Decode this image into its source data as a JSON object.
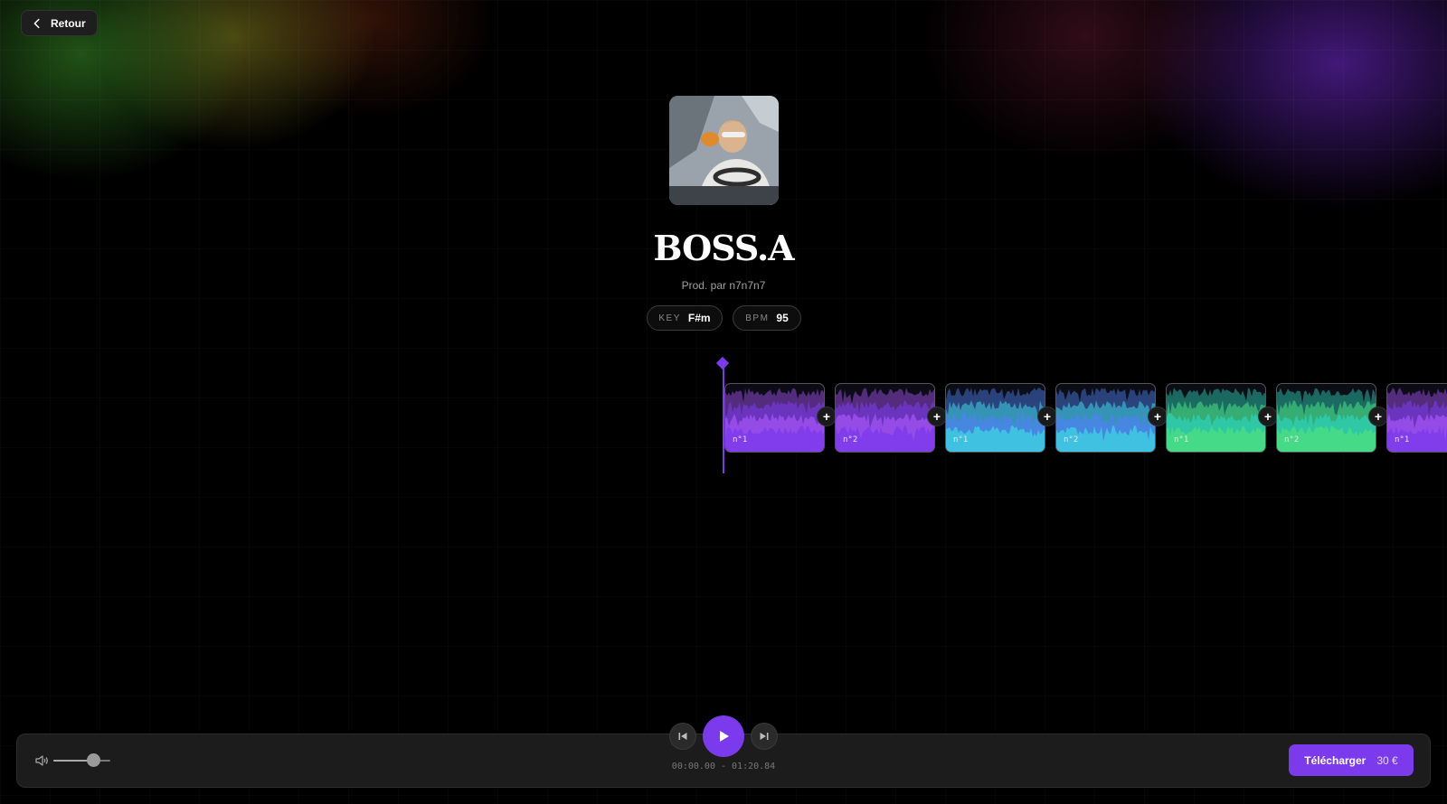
{
  "nav": {
    "back_label": "Retour"
  },
  "track": {
    "title": "BOSS.A",
    "producer": "Prod. par n7n7n7",
    "key_label": "KEY",
    "key_value": "F#m",
    "bpm_label": "BPM",
    "bpm_value": "95"
  },
  "timeline": {
    "clips": [
      {
        "label": "n°1",
        "color": "#a855f7",
        "color2": "#7c3aed"
      },
      {
        "label": "n°2",
        "color": "#a855f7",
        "color2": "#7c3aed"
      },
      {
        "label": "n°1",
        "color": "#4f7ff5",
        "color2": "#3ecfe0"
      },
      {
        "label": "n°2",
        "color": "#4f7ff5",
        "color2": "#3ecfe0"
      },
      {
        "label": "n°1",
        "color": "#2dd4bf",
        "color2": "#4ade80"
      },
      {
        "label": "n°2",
        "color": "#2dd4bf",
        "color2": "#4ade80"
      },
      {
        "label": "n°1",
        "color": "#a855f7",
        "color2": "#7c3aed"
      }
    ]
  },
  "player": {
    "time": "00:00.00 - 01:20.84",
    "volume": 0.7,
    "download_label": "Télécharger",
    "price": "30 €"
  },
  "colors": {
    "accent": "#7c3aed"
  }
}
